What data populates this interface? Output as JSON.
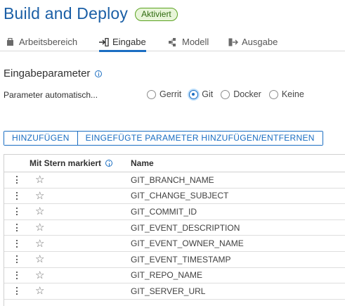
{
  "header": {
    "title": "Build and Deploy",
    "status_badge": "Aktiviert"
  },
  "tabs": [
    {
      "label": "Arbeitsbereich",
      "icon": "workspace-icon",
      "active": false
    },
    {
      "label": "Eingabe",
      "icon": "input-icon",
      "active": true
    },
    {
      "label": "Modell",
      "icon": "model-icon",
      "active": false
    },
    {
      "label": "Ausgabe",
      "icon": "output-icon",
      "active": false
    }
  ],
  "section": {
    "title": "Eingabeparameter",
    "param_label": "Parameter automatisch...",
    "radio_options": [
      {
        "label": "Gerrit",
        "checked": false
      },
      {
        "label": "Git",
        "checked": true
      },
      {
        "label": "Docker",
        "checked": false
      },
      {
        "label": "Keine",
        "checked": false
      }
    ]
  },
  "buttons": {
    "add": "HINZUFÜGEN",
    "add_remove_injected": "EINGEFÜGTE PARAMETER HINZUFÜGEN/ENTFERNEN"
  },
  "table": {
    "columns": {
      "starred": "Mit Stern markiert",
      "name": "Name"
    },
    "rows": [
      "GIT_BRANCH_NAME",
      "GIT_CHANGE_SUBJECT",
      "GIT_COMMIT_ID",
      "GIT_EVENT_DESCRIPTION",
      "GIT_EVENT_OWNER_NAME",
      "GIT_EVENT_TIMESTAMP",
      "GIT_REPO_NAME",
      "GIT_SERVER_URL"
    ]
  },
  "colors": {
    "title": "#1b5fa6",
    "accent": "#1b6ec2",
    "badge_border": "#5aa220",
    "badge_bg": "#e8f5d9"
  }
}
